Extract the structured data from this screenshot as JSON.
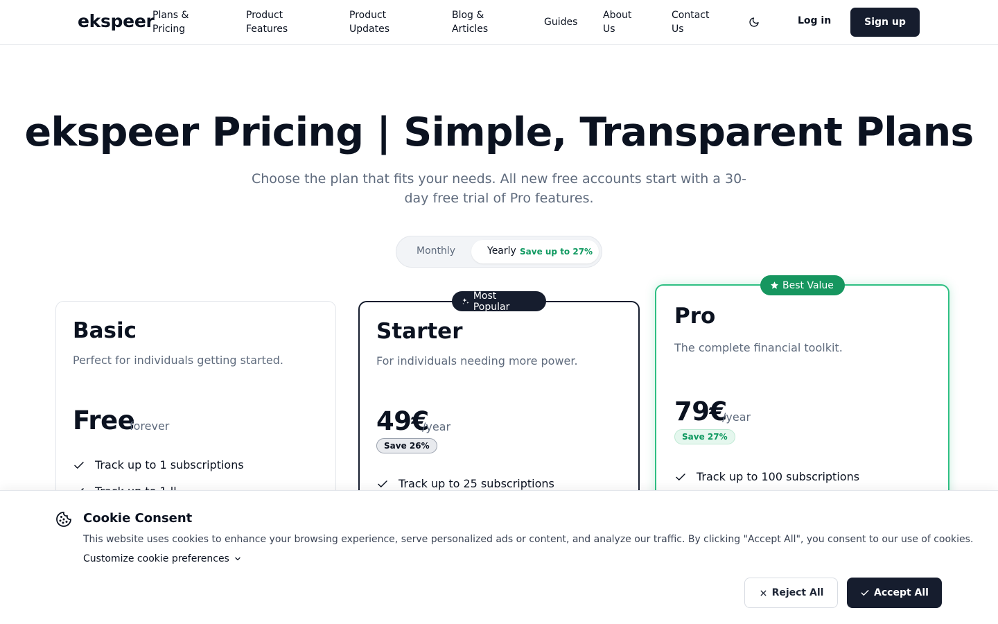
{
  "header": {
    "logo": "ekspeer",
    "nav": [
      {
        "label": "Plans &\nPricing"
      },
      {
        "label": "Product\nFeatures"
      },
      {
        "label": "Product\nUpdates"
      },
      {
        "label": "Blog &\nArticles"
      },
      {
        "label": "Guides"
      },
      {
        "label": "About\nUs"
      },
      {
        "label": "Contact\nUs"
      }
    ],
    "theme_icon": "moon-icon",
    "login_label": "Log in",
    "signup_label": "Sign up"
  },
  "hero": {
    "title": "ekspeer Pricing | Simple, Transparent Plans",
    "subtitle": "Choose the plan that fits your needs. All new free accounts start with a 30-day free trial of Pro features."
  },
  "billing_toggle": {
    "monthly_label": "Monthly",
    "yearly_label": "Yearly",
    "yearly_save": "Save up to 27%",
    "selected": "Yearly"
  },
  "plans": [
    {
      "name": "Basic",
      "description": "Perfect for individuals getting started.",
      "price": "Free",
      "price_unit": "forever",
      "save": "",
      "features": [
        "Track up to 1 subscriptions",
        "Track up to 1 ll"
      ]
    },
    {
      "name": "Starter",
      "badge": "Most Popular",
      "badge_icon": "sparkles-icon",
      "description": "For individuals needing more power.",
      "price": "49€",
      "price_unit": "/year",
      "save": "Save 26%",
      "features": [
        "Track up to 25 subscriptions"
      ]
    },
    {
      "name": "Pro",
      "badge": "Best Value",
      "badge_icon": "star-icon",
      "description": "The complete financial toolkit.",
      "price": "79€",
      "price_unit": "/year",
      "save": "Save 27%",
      "features": [
        "Track up to 100 subscriptions"
      ]
    }
  ],
  "cookie": {
    "icon": "cookie-icon",
    "title": "Cookie Consent",
    "text": "This website uses cookies to enhance your browsing experience, serve personalized ads or content, and analyze our traffic. By clicking \"Accept All\", you consent to our use of cookies.",
    "customize_label": "Customize cookie preferences",
    "reject_label": "Reject All",
    "accept_label": "Accept All"
  },
  "colors": {
    "primary_dark": "#161d2e",
    "accent_green": "#16965f",
    "pro_border": "#2fbf83",
    "muted_text": "#5f6b7d"
  }
}
